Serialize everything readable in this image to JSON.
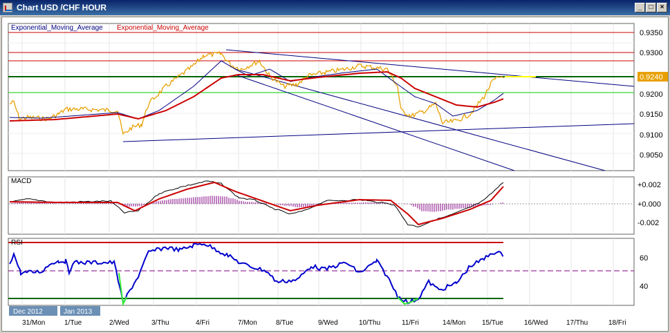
{
  "window": {
    "title": "Chart USD /CHF  HOUR",
    "minimize_label": "_",
    "maximize_label": "□",
    "close_label": "×"
  },
  "main_panel": {
    "legend_1": "Exponential_Moving_Average",
    "legend_2": "Exponential_Moving_Average",
    "price_labels": [
      "0.9350",
      "0.9300",
      "0.9250",
      "0.9200",
      "0.9150",
      "0.9100",
      "0.9050"
    ],
    "current_price": "0.9240"
  },
  "macd_panel": {
    "label": "MACD",
    "scale_labels": [
      "+0.002",
      "+0.000",
      "-0.002"
    ]
  },
  "rsi_panel": {
    "label": "RSI",
    "scale_labels": [
      "60",
      "40"
    ]
  },
  "time_axis": {
    "month_tags": [
      "Dec 2012",
      "Jan 2013"
    ],
    "day_labels": [
      "31/Mon",
      "1/Tue",
      "2/Wed",
      "3/Thu",
      "4/Fri",
      "7/Mon",
      "8/Tue",
      "9/Wed",
      "10/Thu",
      "11/Fri",
      "14/Mon",
      "15/Tue",
      "16/Wed",
      "17/Thu",
      "18/Fri"
    ]
  },
  "colors": {
    "price_line": "#e8a000",
    "ema_fast": "#000080",
    "ema_slow": "#cc0000",
    "resistance": "#cc0000",
    "support_green": "#00aa00",
    "rsi_line": "#0000cc",
    "histogram": "#800080"
  }
}
